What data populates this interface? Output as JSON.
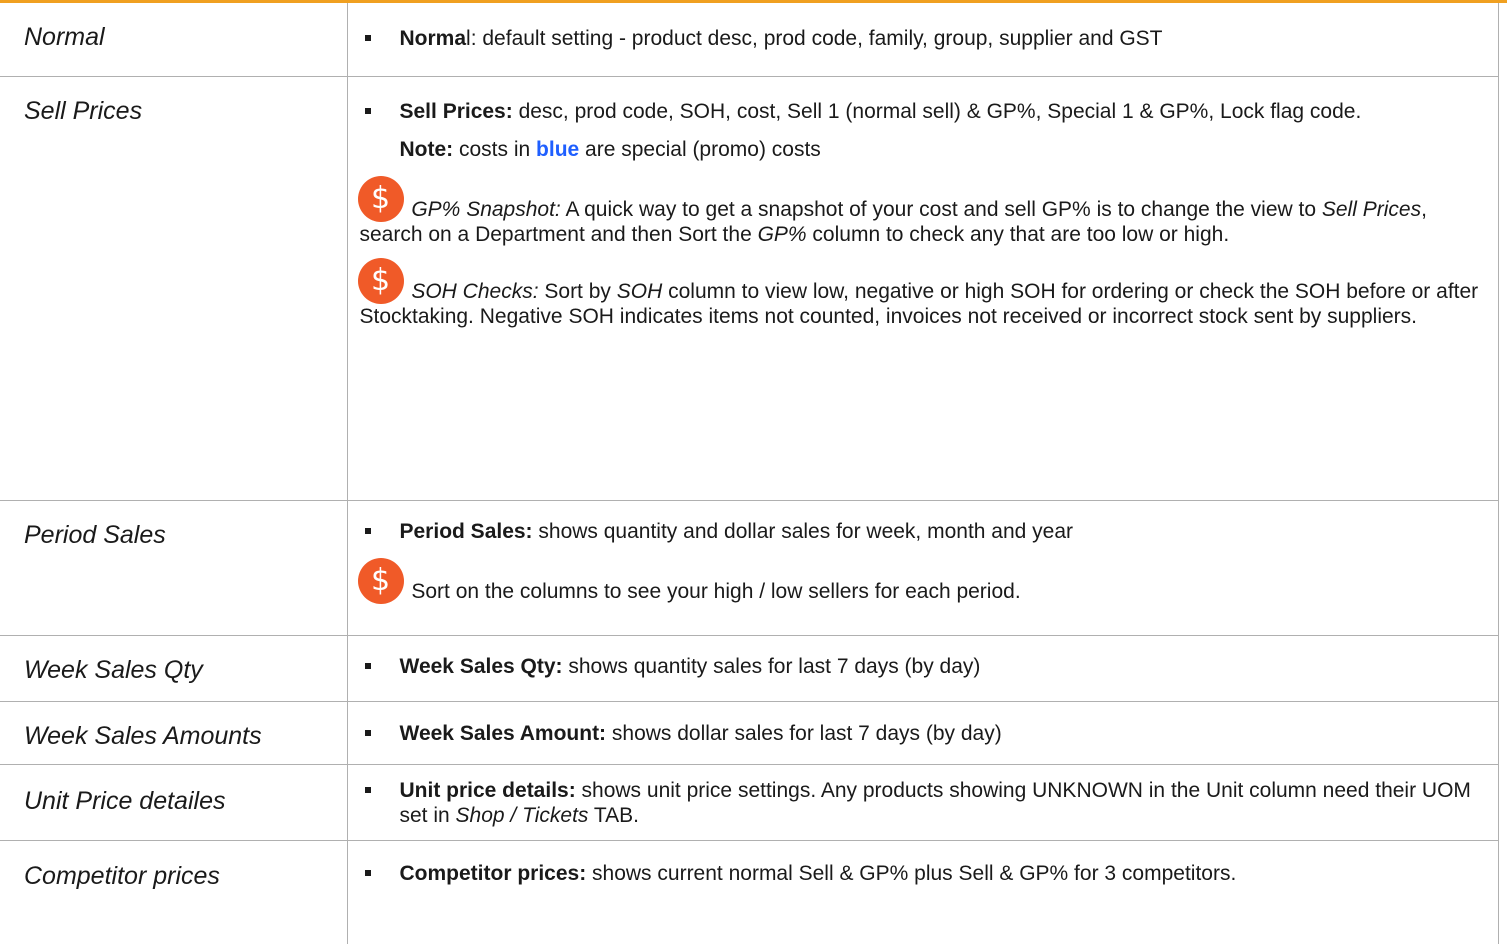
{
  "accent_color": "#f0a020",
  "tip_icon_color": "#f05a28",
  "rows": {
    "normal": {
      "name": "Normal",
      "label": "Norma",
      "label_tail": "l",
      "text": ": default setting - product desc, prod code, family, group, supplier and GST"
    },
    "sell": {
      "name": "Sell Prices",
      "label": "Sell Prices:",
      "text": " desc, prod code, SOH, cost, Sell 1 (normal sell) & GP%, Special 1 & GP%, Lock flag code.",
      "note_label": "Note:",
      "note_pre": " costs in ",
      "note_blue": "blue",
      "note_post": " are special (promo) costs",
      "tip1_title": "GP% Snapshot:",
      "tip1_a": "  A quick way to get a snapshot of your cost and sell GP% is to change the view to ",
      "tip1_view": "Sell Prices",
      "tip1_b": ", search on a Department and then Sort the ",
      "tip1_col": "GP%",
      "tip1_c": " column to check any that are too low or high.",
      "tip2_title": "SOH Checks:",
      "tip2_a": "  Sort by ",
      "tip2_col": "SOH",
      "tip2_b": " column to view low, negative or high SOH for ordering or check the SOH before or after Stocktaking.  Negative SOH indicates items not counted, invoices not received or incorrect stock sent by suppliers."
    },
    "period": {
      "name": "Period Sales",
      "label": "Period Sales:",
      "text": " shows quantity and dollar sales for week, month and year",
      "tip": "Sort on the columns to see your high / low sellers for each period."
    },
    "weekqty": {
      "name": "Week Sales Qty",
      "label": "Week Sales Qty:",
      "text": "  shows quantity sales for last 7 days (by day)"
    },
    "weekamt": {
      "name": "Week Sales Amounts",
      "label": "Week Sales Amount:",
      "text": "  shows dollar sales for last 7 days (by day)"
    },
    "unit": {
      "name": "Unit Price detailes",
      "label": "Unit price details:",
      "text": " shows unit price settings.  Any products showing UNKNOWN in the Unit column need their UOM set in ",
      "tab": "Shop / Tickets",
      "text_end": " TAB."
    },
    "comp": {
      "name": "Competitor prices",
      "label": "Competitor prices:",
      "text": " shows current normal Sell & GP%  plus Sell & GP% for 3 competitors."
    }
  },
  "icons": {
    "tip": "dollar-coin-icon",
    "bullet": "square-bullet-icon"
  },
  "dollar_glyph": "$"
}
